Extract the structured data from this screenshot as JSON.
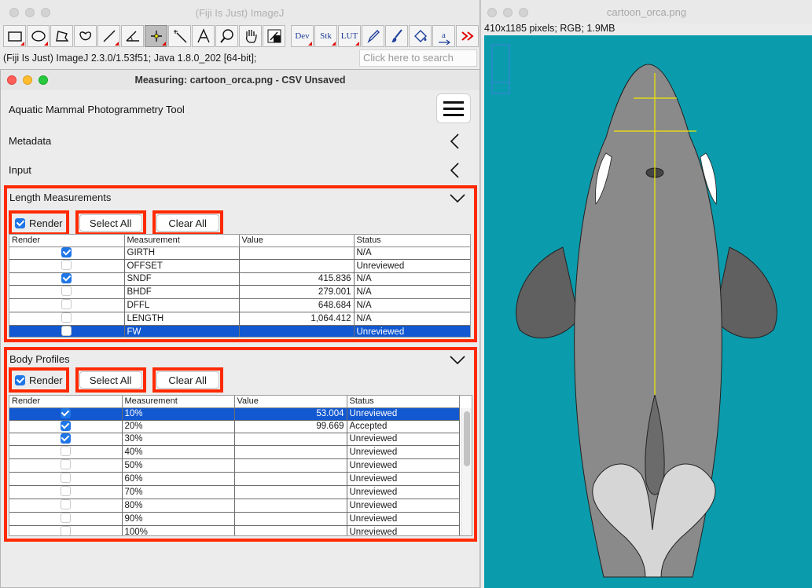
{
  "imagej": {
    "window_title": "(Fiji Is Just) ImageJ",
    "status_text": "(Fiji Is Just) ImageJ 2.3.0/1.53f51; Java 1.8.0_202 [64-bit];",
    "search_placeholder": "Click here to search",
    "tools": [
      {
        "name": "rectangle-tool-icon"
      },
      {
        "name": "oval-tool-icon"
      },
      {
        "name": "polygon-tool-icon"
      },
      {
        "name": "freehand-tool-icon"
      },
      {
        "name": "line-tool-icon"
      },
      {
        "name": "angle-tool-icon"
      },
      {
        "name": "point-tool-icon",
        "active": true
      },
      {
        "name": "wand-tool-icon"
      },
      {
        "name": "text-tool-icon"
      },
      {
        "name": "magnifier-tool-icon"
      },
      {
        "name": "hand-tool-icon"
      },
      {
        "name": "color-picker-icon"
      },
      {
        "label": "Dev",
        "name": "dev-menu-button"
      },
      {
        "label": "Stk",
        "name": "stk-menu-button"
      },
      {
        "label": "LUT",
        "name": "lut-menu-button"
      },
      {
        "name": "pencil-tool-icon"
      },
      {
        "name": "brush-tool-icon"
      },
      {
        "name": "flood-fill-tool-icon"
      },
      {
        "name": "arrow-label-tool-icon"
      },
      {
        "name": "more-tools-icon"
      }
    ]
  },
  "measure": {
    "window_title": "Measuring: cartoon_orca.png  - CSV Unsaved",
    "tool_name": "Aquatic Mammal Photogrammetry Tool",
    "metadata_label": "Metadata",
    "input_label": "Input",
    "length": {
      "title": "Length Measurements",
      "render_label": "Render",
      "render_checked": true,
      "select_all": "Select All",
      "clear_all": "Clear All",
      "columns": [
        "Render",
        "Measurement",
        "Value",
        "Status"
      ],
      "rows": [
        {
          "render": true,
          "measurement": "GIRTH",
          "value": "",
          "status": "N/A"
        },
        {
          "render": false,
          "measurement": "OFFSET",
          "value": "",
          "status": "Unreviewed"
        },
        {
          "render": true,
          "measurement": "SNDF",
          "value": "415.836",
          "status": "N/A"
        },
        {
          "render": false,
          "measurement": "BHDF",
          "value": "279.001",
          "status": "N/A"
        },
        {
          "render": false,
          "measurement": "DFFL",
          "value": "648.684",
          "status": "N/A"
        },
        {
          "render": false,
          "measurement": "LENGTH",
          "value": "1,064.412",
          "status": "N/A"
        },
        {
          "render": false,
          "measurement": "FW",
          "value": "",
          "status": "Unreviewed",
          "selected": true
        }
      ]
    },
    "profiles": {
      "title": "Body Profiles",
      "render_label": "Render",
      "render_checked": true,
      "select_all": "Select All",
      "clear_all": "Clear All",
      "columns": [
        "Render",
        "Measurement",
        "Value",
        "Status"
      ],
      "rows": [
        {
          "render": true,
          "measurement": "10%",
          "value": "53.004",
          "status": "Unreviewed",
          "selected": true
        },
        {
          "render": true,
          "measurement": "20%",
          "value": "99.669",
          "status": "Accepted"
        },
        {
          "render": true,
          "measurement": "30%",
          "value": "",
          "status": "Unreviewed"
        },
        {
          "render": false,
          "measurement": "40%",
          "value": "",
          "status": "Unreviewed"
        },
        {
          "render": false,
          "measurement": "50%",
          "value": "",
          "status": "Unreviewed"
        },
        {
          "render": false,
          "measurement": "60%",
          "value": "",
          "status": "Unreviewed"
        },
        {
          "render": false,
          "measurement": "70%",
          "value": "",
          "status": "Unreviewed"
        },
        {
          "render": false,
          "measurement": "80%",
          "value": "",
          "status": "Unreviewed"
        },
        {
          "render": false,
          "measurement": "90%",
          "value": "",
          "status": "Unreviewed"
        },
        {
          "render": false,
          "measurement": "100%",
          "value": "",
          "status": "Unreviewed"
        }
      ]
    }
  },
  "image": {
    "window_title": "cartoon_orca.png",
    "info": "410x1185 pixels; RGB; 1.9MB"
  },
  "colors": {
    "highlight": "#ff2a00",
    "selection": "#1258d0",
    "canvas_bg": "#0a9cad",
    "measure_line": "#f2e600"
  }
}
